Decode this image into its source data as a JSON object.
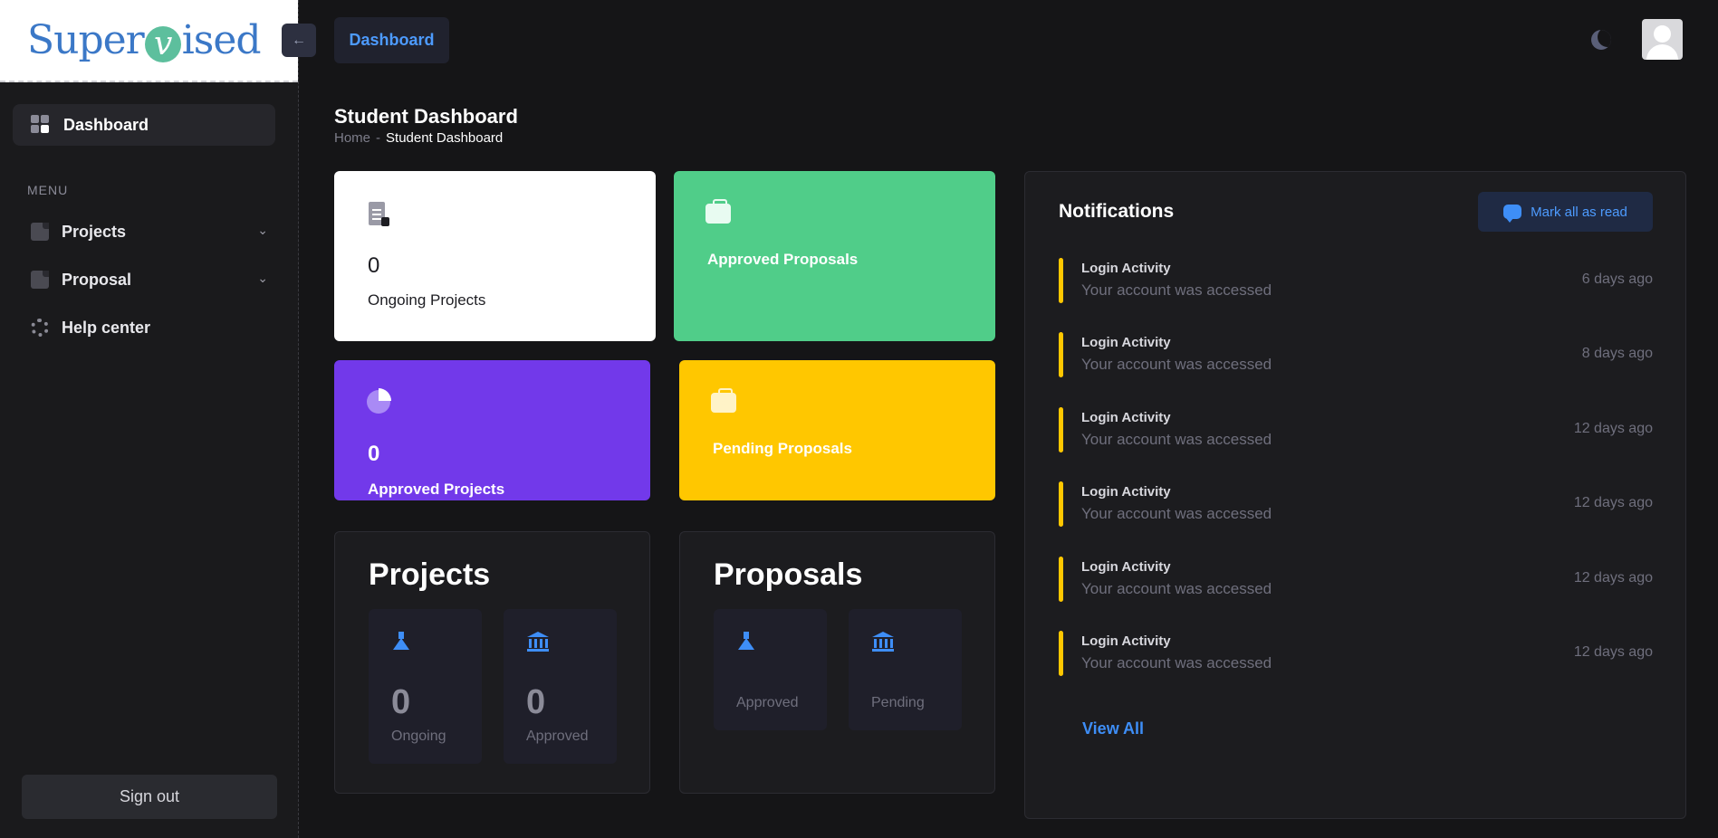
{
  "brand": {
    "logo_text_1": "Super",
    "logo_letter": "v",
    "logo_text_2": "ised",
    "accent": "#3b78c7"
  },
  "sidebar": {
    "active_item": "Dashboard",
    "menu_label": "MENU",
    "items": [
      {
        "label": "Projects",
        "icon": "document-icon",
        "expandable": true
      },
      {
        "label": "Proposal",
        "icon": "document-icon",
        "expandable": true
      },
      {
        "label": "Help center",
        "icon": "lifebuoy-icon",
        "expandable": false
      }
    ],
    "signout_label": "Sign out"
  },
  "header": {
    "collapse_icon": "arrow-left-icon",
    "tab_label": "Dashboard",
    "theme_icon": "moon-icon",
    "avatar_icon": "user-avatar-icon"
  },
  "page": {
    "title": "Student Dashboard",
    "breadcrumb": {
      "home": "Home",
      "separator": "-",
      "current": "Student Dashboard"
    }
  },
  "stats": {
    "ongoing_projects": {
      "value": "0",
      "label": "Ongoing Projects",
      "color": "#ffffff",
      "icon": "clipboard-icon"
    },
    "approved_proposals": {
      "label": "Approved Proposals",
      "color": "#50cd89",
      "icon": "briefcase-icon"
    },
    "approved_projects": {
      "value": "0",
      "label": "Approved Projects",
      "color": "#7239ea",
      "icon": "pie-chart-icon"
    },
    "pending_proposals": {
      "label": "Pending Proposals",
      "color": "#ffc700",
      "icon": "briefcase-icon"
    }
  },
  "projects_panel": {
    "title": "Projects",
    "ongoing": {
      "value": "0",
      "label": "Ongoing",
      "icon": "flask-icon"
    },
    "approved": {
      "value": "0",
      "label": "Approved",
      "icon": "bank-icon"
    }
  },
  "proposals_panel": {
    "title": "Proposals",
    "approved": {
      "label": "Approved",
      "icon": "flask-icon"
    },
    "pending": {
      "label": "Pending",
      "icon": "bank-icon"
    }
  },
  "notifications": {
    "title": "Notifications",
    "mark_all_label": "Mark all as read",
    "items": [
      {
        "title": "Login Activity",
        "body": "Your account was accessed",
        "time": "6 days ago"
      },
      {
        "title": "Login Activity",
        "body": "Your account was accessed",
        "time": "8 days ago"
      },
      {
        "title": "Login Activity",
        "body": "Your account was accessed",
        "time": "12 days ago"
      },
      {
        "title": "Login Activity",
        "body": "Your account was accessed",
        "time": "12 days ago"
      },
      {
        "title": "Login Activity",
        "body": "Your account was accessed",
        "time": "12 days ago"
      },
      {
        "title": "Login Activity",
        "body": "Your account was accessed",
        "time": "12 days ago"
      }
    ],
    "view_all_label": "View All",
    "accent": "#ffc700"
  }
}
